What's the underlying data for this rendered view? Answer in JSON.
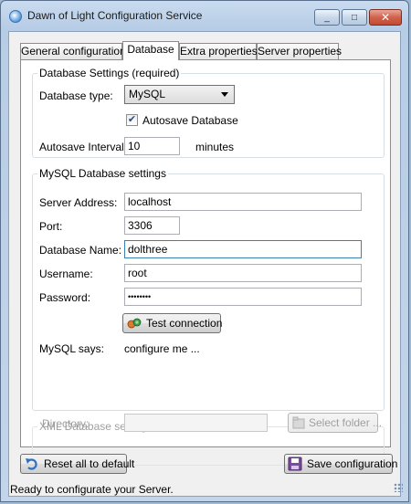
{
  "window": {
    "title": "Dawn of Light Configuration Service",
    "minimize_glyph": "_",
    "maximize_glyph": "□",
    "close_glyph": "✕"
  },
  "tabs": [
    {
      "label": "General configuration",
      "active": false
    },
    {
      "label": "Database",
      "active": true
    },
    {
      "label": "Extra properties",
      "active": false
    },
    {
      "label": "Server properties",
      "active": false
    }
  ],
  "db_settings": {
    "legend": "Database Settings (required)",
    "type_label": "Database type:",
    "type_value": "MySQL",
    "autosave_label": "Autosave Database",
    "autosave_checked": true,
    "interval_label": "Autosave Interval:",
    "interval_value": "10",
    "interval_unit": "minutes"
  },
  "mysql": {
    "legend": "MySQL Database settings",
    "server_label": "Server Address:",
    "server_value": "localhost",
    "port_label": "Port:",
    "port_value": "3306",
    "dbname_label": "Database Name:",
    "dbname_value": "dolthree",
    "user_label": "Username:",
    "user_value": "root",
    "password_label": "Password:",
    "password_value": "••••••••",
    "test_button": "Test connection",
    "says_label": "MySQL says:",
    "says_value": "configure me ..."
  },
  "xml": {
    "legend": "XML Database settings",
    "directory_label": "Directory:",
    "directory_value": "",
    "select_button": "Select folder ..."
  },
  "footer": {
    "reset_button": "Reset all to default",
    "save_button": "Save configuration"
  },
  "status": {
    "text": "Ready to configurate your Server."
  }
}
